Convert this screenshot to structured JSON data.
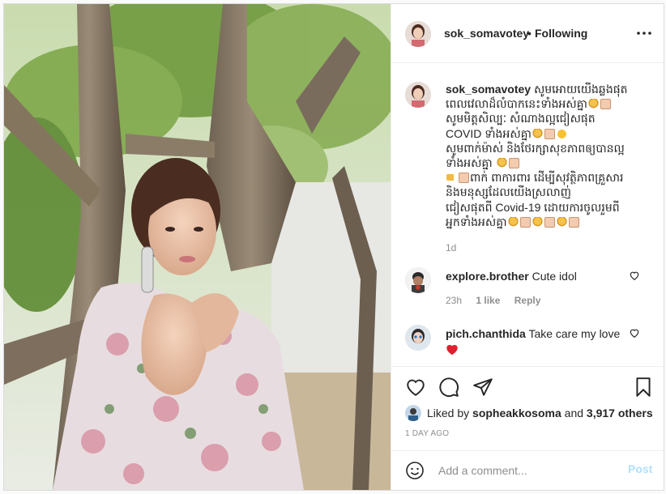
{
  "post": {
    "username": "sok_somavotey",
    "separator": "•",
    "follow_status": "Following",
    "caption_lines": [
      [
        "សូមអោយយើងឆ្លងផុត",
        []
      ],
      [
        "ពេលវេលាដ៏លំបាកនេះទាំងអស់គ្នា",
        [
          "hands",
          "sq"
        ]
      ],
      [
        "សូមមិត្តសិល្បៈ សំណាងល្អជៀសផុត",
        []
      ],
      [
        "COVID ទាំងអស់គ្នា",
        [
          "hands",
          "sq",
          "face"
        ]
      ],
      [
        "សូមពាក់ម៉ាស់ និងថែរក្សាសុខភាពឲ្យបានល្អ",
        []
      ],
      [
        "ទាំងអស់គ្នា ",
        [
          "hands",
          "sq"
        ]
      ],
      [
        "",
        [
          "point",
          "sq"
        ],
        "ពាក់ ពាការពារ ដើម្បីសុវត្ថិភាពគ្រួសារ"
      ],
      [
        "និងមនុស្សដែលយើងស្រលាញ់",
        []
      ],
      [
        "ជៀសផុតពី Covid-19 ដោយការចូលរួមពី",
        []
      ],
      [
        "អ្នកទាំងអស់គ្នា",
        [
          "hands",
          "sq",
          "hands",
          "sq",
          "hands",
          "sq"
        ]
      ]
    ],
    "caption_age": "1d"
  },
  "comments": [
    {
      "username": "explore.brother",
      "text": "Cute idol",
      "time": "23h",
      "likes": "1 like",
      "reply": "Reply"
    },
    {
      "username": "pich.chanthida",
      "text": "Take care my love",
      "emoji": "red-heart"
    }
  ],
  "likes": {
    "prefix": "Liked by",
    "user": "sopheakkosoma",
    "and": "and",
    "others": "3,917 others"
  },
  "date": "1 DAY AGO",
  "add_comment": {
    "placeholder": "Add a comment...",
    "post_label": "Post"
  },
  "colors": {
    "link": "#0095f6",
    "post_disabled": "#b2dffc",
    "heart": "#ed4956",
    "muted": "#8e8e8e"
  }
}
